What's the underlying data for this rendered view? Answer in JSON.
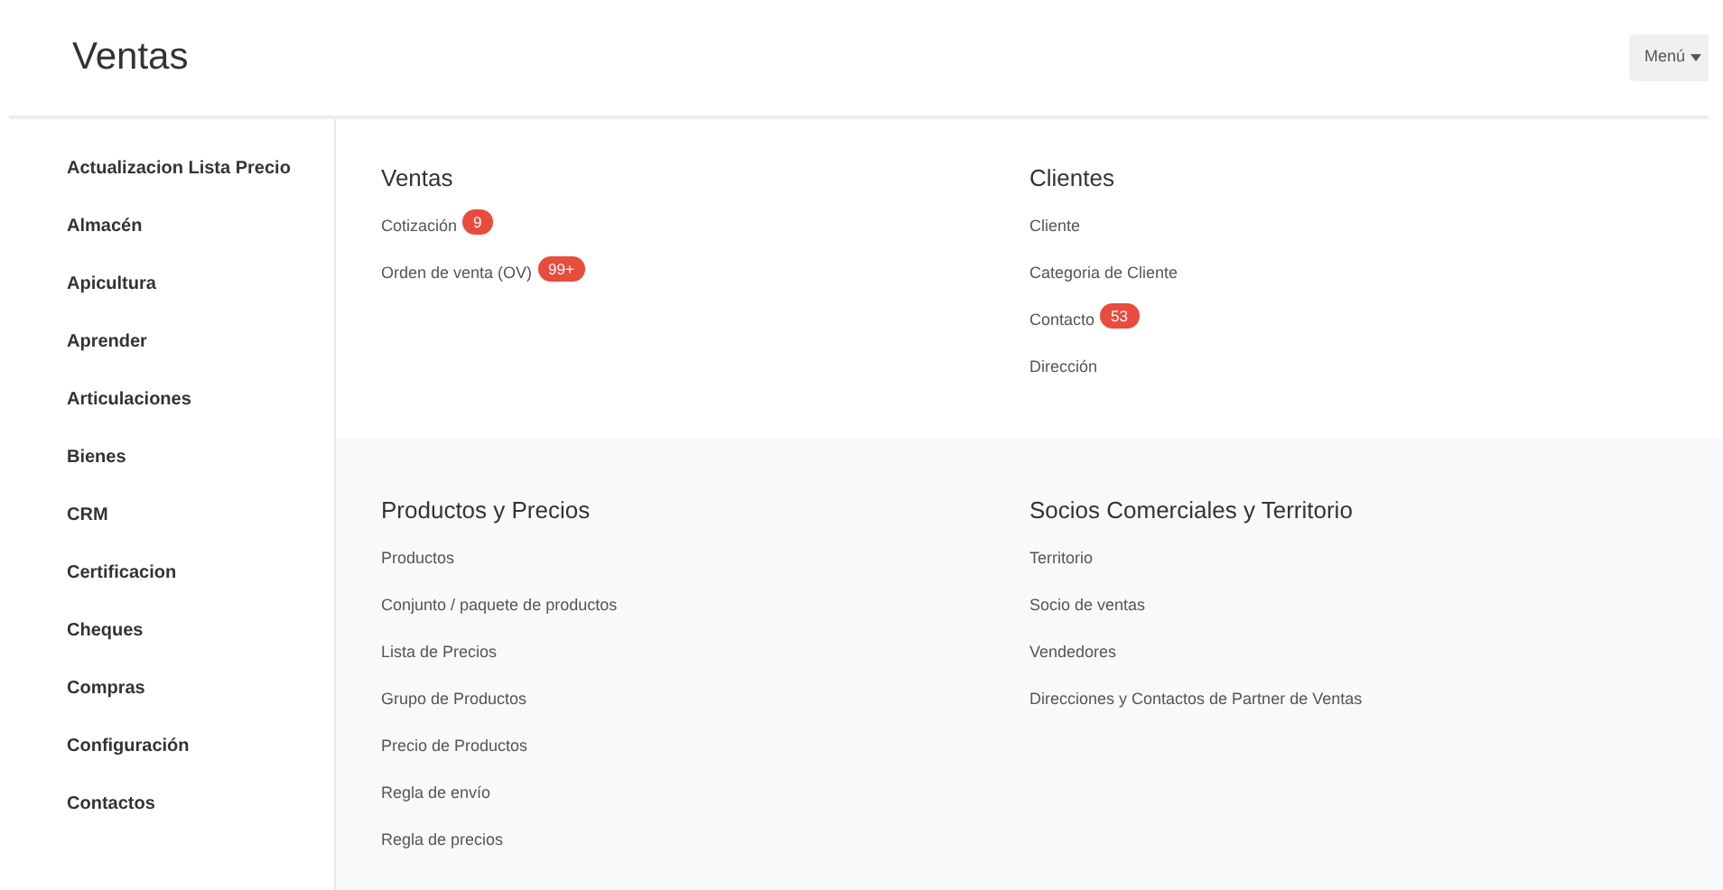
{
  "header": {
    "title": "Ventas",
    "menu_button": "Menú"
  },
  "sidebar": {
    "items": [
      {
        "label": "Actualizacion Lista Precio"
      },
      {
        "label": "Almacén"
      },
      {
        "label": "Apicultura"
      },
      {
        "label": "Aprender"
      },
      {
        "label": "Articulaciones"
      },
      {
        "label": "Bienes"
      },
      {
        "label": "CRM"
      },
      {
        "label": "Certificacion"
      },
      {
        "label": "Cheques"
      },
      {
        "label": "Compras"
      },
      {
        "label": "Configuración"
      },
      {
        "label": "Contactos"
      }
    ]
  },
  "sections": [
    {
      "title": "Ventas",
      "links": [
        {
          "label": "Cotización",
          "badge": "9"
        },
        {
          "label": "Orden de venta (OV)",
          "badge": "99+"
        }
      ]
    },
    {
      "title": "Clientes",
      "links": [
        {
          "label": "Cliente"
        },
        {
          "label": "Categoria de Cliente"
        },
        {
          "label": "Contacto",
          "badge": "53"
        },
        {
          "label": "Dirección"
        }
      ]
    },
    {
      "title": "Productos y Precios",
      "links": [
        {
          "label": "Productos"
        },
        {
          "label": "Conjunto / paquete de productos"
        },
        {
          "label": "Lista de Precios"
        },
        {
          "label": "Grupo de Productos"
        },
        {
          "label": "Precio de Productos"
        },
        {
          "label": "Regla de envío"
        },
        {
          "label": "Regla de precios"
        }
      ]
    },
    {
      "title": "Socios Comerciales y Territorio",
      "links": [
        {
          "label": "Territorio"
        },
        {
          "label": "Socio de ventas"
        },
        {
          "label": "Vendedores"
        },
        {
          "label": "Direcciones y Contactos de Partner de Ventas"
        }
      ]
    }
  ]
}
